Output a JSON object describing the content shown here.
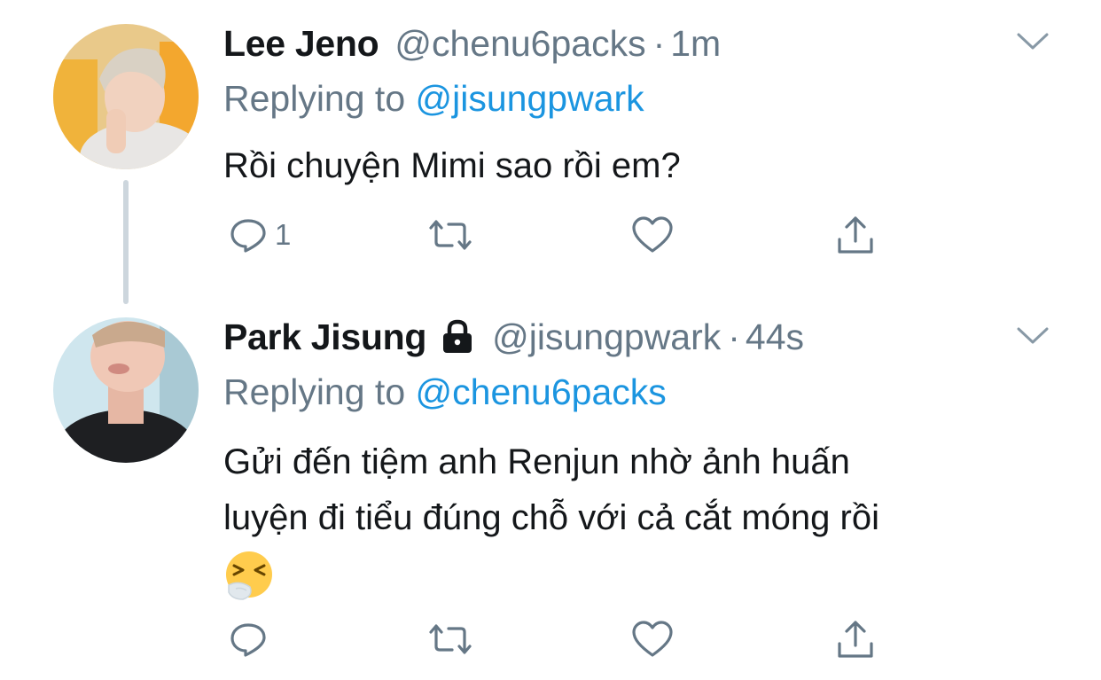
{
  "tweets": [
    {
      "name": "Lee Jeno",
      "handle": "@chenu6packs",
      "dot": "·",
      "time": "1m",
      "replying_prefix": "Replying to",
      "replying_to": "@jisungpwark",
      "text": "Rồi chuyện Mimi sao rồi em?",
      "reply_count": "1",
      "avatar_icon": "avatar-photo"
    },
    {
      "name": "Park Jisung",
      "handle": "@jisungpwark",
      "dot": "·",
      "time": "44s",
      "replying_prefix": "Replying to",
      "replying_to": "@chenu6packs",
      "text_line1": "Gửi đến tiệm anh Renjun nhờ ảnh huấn",
      "text_line2": "luyện đi tiểu đúng chỗ với cả cắt móng rồi",
      "emoji": "sneezing-face-emoji",
      "reply_count": "",
      "protected_icon": "lock-icon",
      "avatar_icon": "avatar-photo"
    }
  ],
  "action_icons": [
    "reply-icon",
    "retweet-icon",
    "like-icon",
    "share-icon"
  ],
  "colors": {
    "text": "#14171a",
    "secondary": "#657786",
    "link": "#1b95e0",
    "thread_line": "#cdd6dd"
  }
}
